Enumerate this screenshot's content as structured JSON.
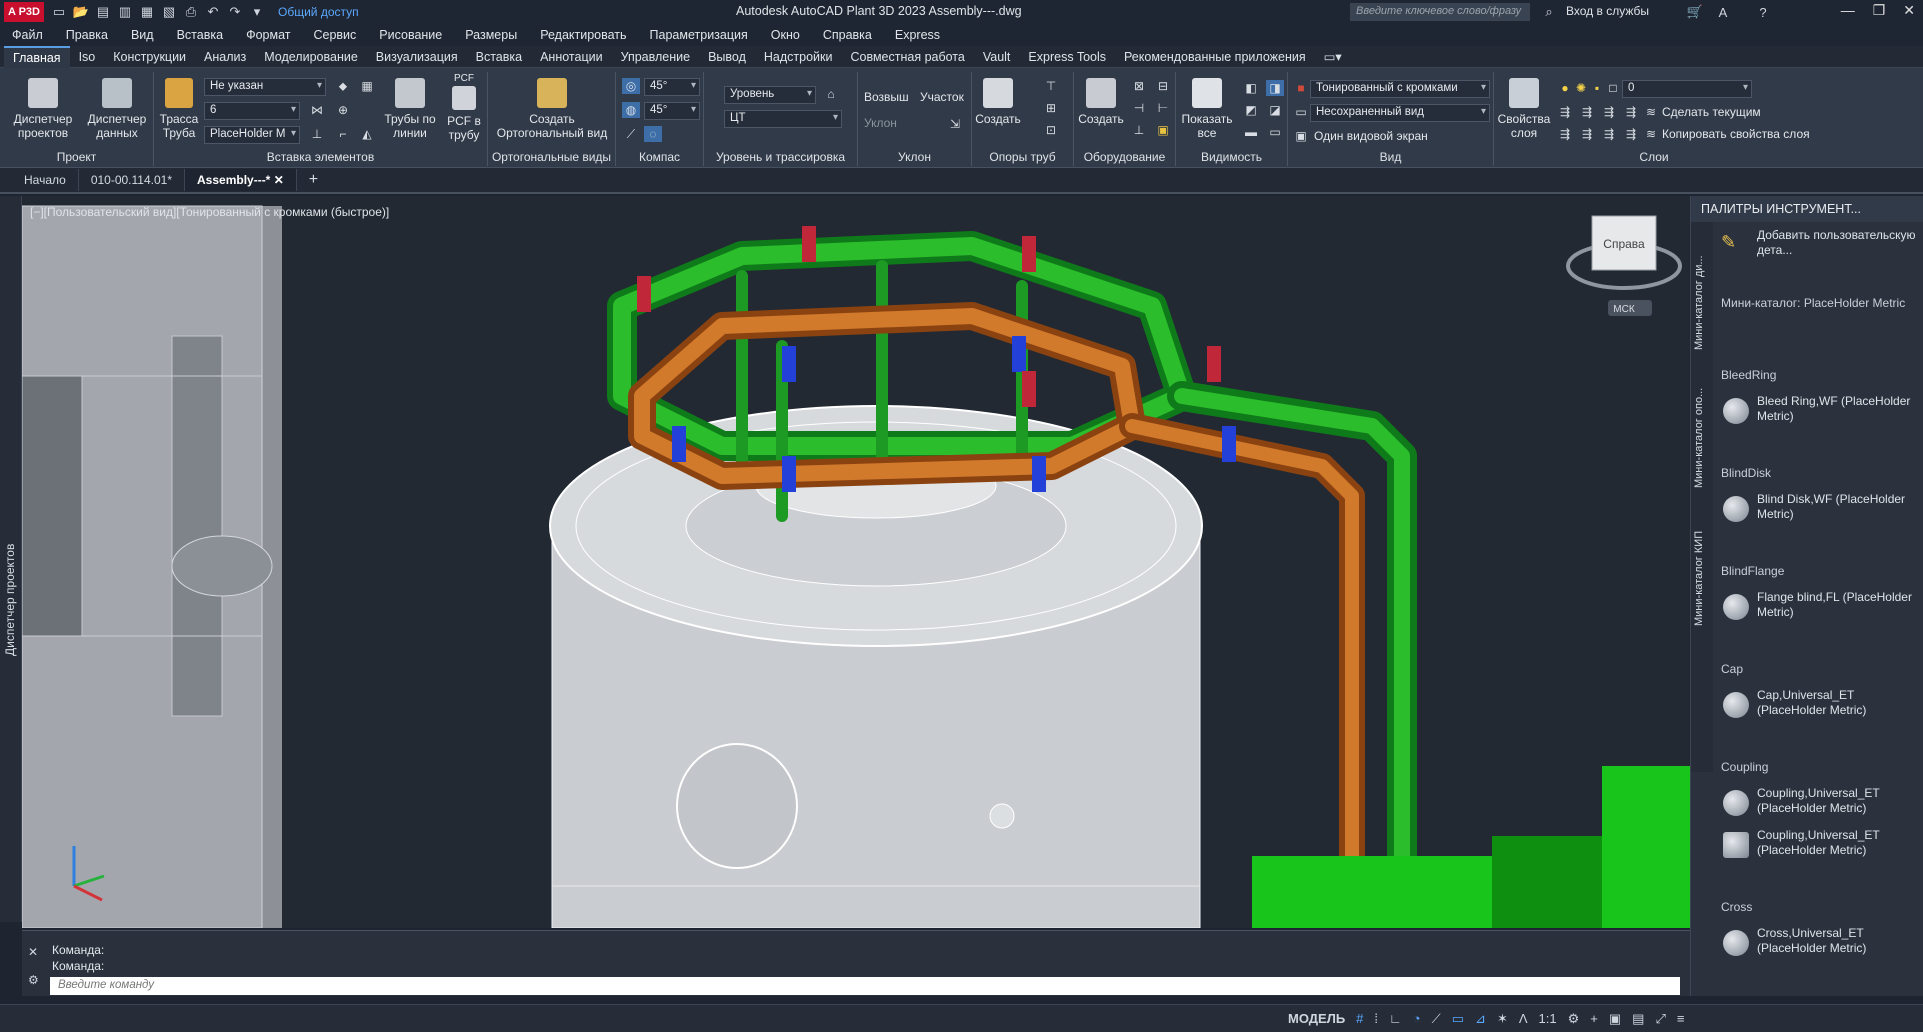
{
  "titlebar": {
    "logo": "A P3D",
    "share": "Общий доступ",
    "title": "Autodesk AutoCAD Plant 3D 2023  Assembly---.dwg",
    "search_placeholder": "Введите ключевое слово/фразу",
    "signin": "Вход в службы"
  },
  "menu": [
    "Файл",
    "Правка",
    "Вид",
    "Вставка",
    "Формат",
    "Сервис",
    "Рисование",
    "Размеры",
    "Редактировать",
    "Параметризация",
    "Окно",
    "Справка",
    "Express"
  ],
  "ribbon_tabs": [
    "Главная",
    "Iso",
    "Конструкции",
    "Анализ",
    "Моделирование",
    "Визуализация",
    "Вставка",
    "Аннотации",
    "Управление",
    "Вывод",
    "Надстройки",
    "Совместная работа",
    "Vault",
    "Express Tools",
    "Рекомендованные приложения"
  ],
  "ribbon": {
    "project": {
      "title": "Проект",
      "btn1": "Диспетчер проектов",
      "btn2": "Диспетчер данных"
    },
    "insert": {
      "title": "Вставка элементов",
      "btn_route": "Трасса Труба",
      "combo1": "Не указан",
      "combo2": "6",
      "combo3": "PlaceHolder M",
      "btn_line": "Трубы по линии",
      "btn_pcf": "PCF в трубу",
      "pcf_label": "PCF"
    },
    "ortho": {
      "title": "Ортогональные виды",
      "btn": "Создать Ортогональный вид"
    },
    "compass": {
      "title": "Компас",
      "angle1": "45°",
      "angle2": "45°"
    },
    "level": {
      "title": "Уровень и трассировка",
      "combo1": "Уровень",
      "combo2": "ЦТ"
    },
    "slope": {
      "title": "Уклон",
      "btn1": "Возвыш",
      "btn2": "Участок",
      "combo": "Уклон"
    },
    "supports": {
      "title": "Опоры труб",
      "btn": "Создать"
    },
    "equipment": {
      "title": "Оборудование",
      "btn": "Создать"
    },
    "visibility": {
      "title": "Видимость",
      "btn": "Показать все"
    },
    "view": {
      "title": "Вид",
      "combo1": "Тонированный с кромками",
      "combo2": "Несохраненный вид",
      "btn": "Один видовой экран"
    },
    "layers": {
      "title": "Слои",
      "btn": "Свойства слоя",
      "combo": "0",
      "btn_current": "Сделать текущим",
      "btn_copy": "Копировать свойства слоя"
    }
  },
  "doc_tabs": [
    "Начало",
    "010-00.114.01*",
    "Assembly---*"
  ],
  "left_strip": "Диспетчер проектов",
  "viewport": {
    "label": "[−][Пользовательский вид][Тонированный с кромками (быстрое)]",
    "cube_label": "Справа",
    "ucs_label": "МСК"
  },
  "command": {
    "line1": "Команда:",
    "line2": "Команда:",
    "placeholder": "Введите команду"
  },
  "palette": {
    "title": "ПАЛИТРЫ ИНСТРУМЕНТ...",
    "tabs": [
      "Мини-каталог ди...",
      "Мини-каталог опо...",
      "Мини-каталог КИП"
    ],
    "add_label": "Добавить пользовательскую дета...",
    "catalog": "Мини-каталог: PlaceHolder Metric",
    "sections": [
      {
        "name": "BleedRing",
        "items": [
          "Bleed Ring,WF (PlaceHolder Metric)"
        ]
      },
      {
        "name": "BlindDisk",
        "items": [
          "Blind Disk,WF (PlaceHolder Metric)"
        ]
      },
      {
        "name": "BlindFlange",
        "items": [
          "Flange blind,FL (PlaceHolder Metric)"
        ]
      },
      {
        "name": "Cap",
        "items": [
          "Cap,Universal_ET (PlaceHolder Metric)"
        ]
      },
      {
        "name": "Coupling",
        "items": [
          "Coupling,Universal_ET (PlaceHolder Metric)",
          "Coupling,Universal_ET (PlaceHolder Metric)"
        ]
      },
      {
        "name": "Cross",
        "items": [
          "Cross,Universal_ET (PlaceHolder Metric)"
        ]
      }
    ]
  },
  "status": {
    "model": "МОДЕЛЬ",
    "scale": "1:1"
  }
}
